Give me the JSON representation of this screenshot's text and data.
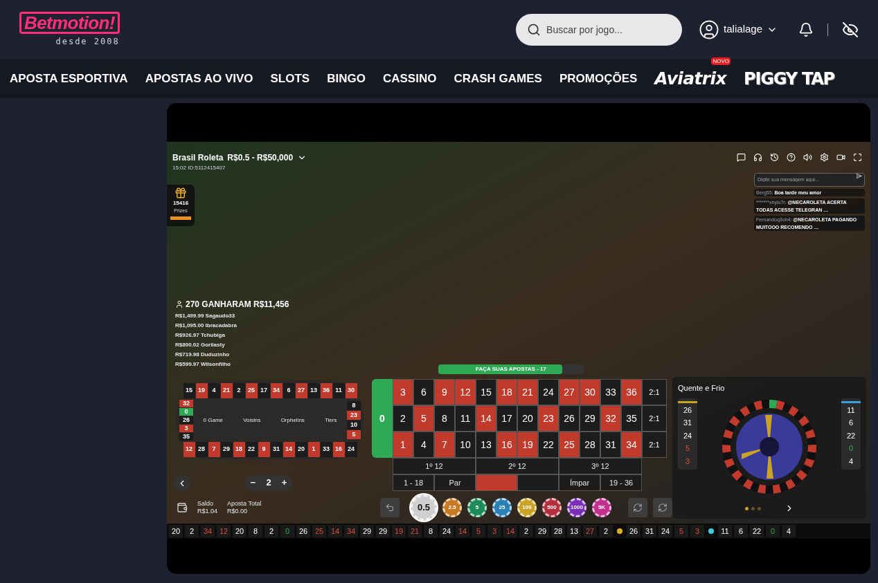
{
  "header": {
    "logo": "Betmotion!",
    "tagline": "desde 2008",
    "search": {
      "placeholder": "Buscar por jogo..."
    },
    "user": "talialage"
  },
  "nav": [
    {
      "kind": "text",
      "label": "APOSTA ESPORTIVA"
    },
    {
      "kind": "text",
      "label": "APOSTAS AO VIVO"
    },
    {
      "kind": "text",
      "label": "SLOTS"
    },
    {
      "kind": "text",
      "label": "BINGO"
    },
    {
      "kind": "text",
      "label": "CASSINO"
    },
    {
      "kind": "text",
      "label": "CRASH GAMES"
    },
    {
      "kind": "text",
      "label": "PROMOÇÕES"
    },
    {
      "kind": "script-logo",
      "label": "Aviatrix",
      "badge": "NOVO"
    },
    {
      "kind": "block-logo",
      "label": "PIGGY TAP"
    }
  ],
  "game": {
    "title": "Brasil Roleta",
    "limits": "R$0.5 - R$50,000",
    "info": "15:02 ID:5112415407",
    "prize": {
      "count": "15416",
      "label": "Prizes"
    },
    "winners": {
      "headline": "270 GANHARAM R$11,456",
      "list": [
        "R$1,499.99 Sagaudo33",
        "R$1,095.00 Ibracadabra",
        "R$926.97 Tchubiga",
        "R$800.02 Gorilasty",
        "R$719.98 Duduzinho",
        "R$599.97 Wilsonfilho"
      ]
    },
    "chat": {
      "placeholder": "Digite sua mensagem aqui...",
      "messages": [
        {
          "user": "Berg55:",
          "text": "Boa tarde meu amor"
        },
        {
          "user": "*******xhyiu7r:",
          "text": "@NECAROLETA ACERTA TODAS ACESSE TELEGRAN …"
        },
        {
          "user": "Fernandoq3ob4:",
          "text": "@NECAROLETA PAGANDO MUITOOO RECOMENDO …"
        }
      ]
    },
    "racetrack": {
      "top": [
        {
          "label": "15",
          "color": "#1c1c1c"
        },
        {
          "label": "19",
          "color": "#c23a2b"
        },
        {
          "label": "4",
          "color": "#1c1c1c"
        },
        {
          "label": "21",
          "color": "#c23a2b"
        },
        {
          "label": "2",
          "color": "#1c1c1c"
        },
        {
          "label": "25",
          "color": "#c23a2b"
        },
        {
          "label": "17",
          "color": "#1c1c1c"
        },
        {
          "label": "34",
          "color": "#c23a2b"
        },
        {
          "label": "6",
          "color": "#1c1c1c"
        },
        {
          "label": "27",
          "color": "#c23a2b"
        },
        {
          "label": "13",
          "color": "#1c1c1c"
        },
        {
          "label": "36",
          "color": "#c23a2b"
        },
        {
          "label": "11",
          "color": "#1c1c1c"
        },
        {
          "label": "30",
          "color": "#c23a2b"
        }
      ],
      "left": [
        {
          "label": "32",
          "color": "#c23a2b"
        },
        {
          "label": "0",
          "color": "#2eaa55"
        },
        {
          "label": "26",
          "color": "#1c1c1c"
        },
        {
          "label": "3",
          "color": "#c23a2b"
        },
        {
          "label": "35",
          "color": "#1c1c1c"
        }
      ],
      "right": [
        {
          "label": "8",
          "color": "#1c1c1c"
        },
        {
          "label": "23",
          "color": "#c23a2b"
        },
        {
          "label": "10",
          "color": "#1c1c1c"
        },
        {
          "label": "5",
          "color": "#c23a2b"
        }
      ],
      "bottom": [
        {
          "label": "12",
          "color": "#c23a2b"
        },
        {
          "label": "28",
          "color": "#1c1c1c"
        },
        {
          "label": "7",
          "color": "#c23a2b"
        },
        {
          "label": "29",
          "color": "#1c1c1c"
        },
        {
          "label": "18",
          "color": "#c23a2b"
        },
        {
          "label": "22",
          "color": "#1c1c1c"
        },
        {
          "label": "9",
          "color": "#c23a2b"
        },
        {
          "label": "31",
          "color": "#1c1c1c"
        },
        {
          "label": "14",
          "color": "#c23a2b"
        },
        {
          "label": "20",
          "color": "#1c1c1c"
        },
        {
          "label": "1",
          "color": "#c23a2b"
        },
        {
          "label": "33",
          "color": "#1c1c1c"
        },
        {
          "label": "16",
          "color": "#c23a2b"
        },
        {
          "label": "24",
          "color": "#1c1c1c"
        }
      ],
      "sections": [
        "0 Game",
        "Voisins",
        "Orphelins",
        "Tiers"
      ]
    },
    "stepper": {
      "minus": "−",
      "value": "2",
      "plus": "+"
    },
    "balance": {
      "label": "Saldo",
      "value": "R$1.04"
    },
    "total_bet": {
      "label": "Aposta Total",
      "value": "R$0.00"
    },
    "timer": {
      "label": "FAÇA SUAS APOSTAS - 17",
      "level": 0.85
    },
    "table": {
      "zero": {
        "label": "0",
        "color": "#2eaa55"
      },
      "number_rows": [
        [
          {
            "label": "3",
            "color": "#c23a2b"
          },
          {
            "label": "6",
            "color": "#1c1c1c"
          },
          {
            "label": "9",
            "color": "#c23a2b"
          },
          {
            "label": "12",
            "color": "#c23a2b"
          },
          {
            "label": "15",
            "color": "#1c1c1c"
          },
          {
            "label": "18",
            "color": "#c23a2b"
          },
          {
            "label": "21",
            "color": "#c23a2b"
          },
          {
            "label": "24",
            "color": "#1c1c1c"
          },
          {
            "label": "27",
            "color": "#c23a2b"
          },
          {
            "label": "30",
            "color": "#c23a2b"
          },
          {
            "label": "33",
            "color": "#1c1c1c"
          },
          {
            "label": "36",
            "color": "#c23a2b"
          }
        ],
        [
          {
            "label": "2",
            "color": "#1c1c1c"
          },
          {
            "label": "5",
            "color": "#c23a2b"
          },
          {
            "label": "8",
            "color": "#1c1c1c"
          },
          {
            "label": "11",
            "color": "#1c1c1c"
          },
          {
            "label": "14",
            "color": "#c23a2b"
          },
          {
            "label": "17",
            "color": "#1c1c1c"
          },
          {
            "label": "20",
            "color": "#1c1c1c"
          },
          {
            "label": "23",
            "color": "#c23a2b"
          },
          {
            "label": "26",
            "color": "#1c1c1c"
          },
          {
            "label": "29",
            "color": "#1c1c1c"
          },
          {
            "label": "32",
            "color": "#c23a2b"
          },
          {
            "label": "35",
            "color": "#1c1c1c"
          }
        ],
        [
          {
            "label": "1",
            "color": "#c23a2b"
          },
          {
            "label": "4",
            "color": "#1c1c1c"
          },
          {
            "label": "7",
            "color": "#c23a2b"
          },
          {
            "label": "10",
            "color": "#1c1c1c"
          },
          {
            "label": "13",
            "color": "#1c1c1c"
          },
          {
            "label": "16",
            "color": "#c23a2b"
          },
          {
            "label": "19",
            "color": "#c23a2b"
          },
          {
            "label": "22",
            "color": "#1c1c1c"
          },
          {
            "label": "25",
            "color": "#c23a2b"
          },
          {
            "label": "28",
            "color": "#1c1c1c"
          },
          {
            "label": "31",
            "color": "#1c1c1c"
          },
          {
            "label": "34",
            "color": "#c23a2b"
          }
        ]
      ],
      "columns": [
        "2:1",
        "2:1",
        "2:1"
      ],
      "dozens": [
        "1º 12",
        "2º 12",
        "3º 12"
      ],
      "outside": [
        {
          "kind": "text",
          "label": "1 - 18"
        },
        {
          "kind": "text",
          "label": "Par"
        },
        {
          "kind": "swatch",
          "color": "#c23a2b"
        },
        {
          "kind": "swatch",
          "color": "#1c1c1c"
        },
        {
          "kind": "text",
          "label": "Ímpar"
        },
        {
          "kind": "text",
          "label": "19 - 36"
        }
      ]
    },
    "chips": [
      {
        "label": "0.5",
        "color": "#cfcfcf",
        "selected": true
      },
      {
        "label": "2.5",
        "color": "#c77a26",
        "selected": false
      },
      {
        "label": "5",
        "color": "#1f8a5a",
        "selected": false
      },
      {
        "label": "25",
        "color": "#2a7fb5",
        "selected": false
      },
      {
        "label": "100",
        "color": "#c9a227",
        "selected": false
      },
      {
        "label": "500",
        "color": "#b3303a",
        "selected": false
      },
      {
        "label": "1000",
        "color": "#7b2fb8",
        "selected": false
      },
      {
        "label": "5K",
        "color": "#c0308c",
        "selected": false
      }
    ],
    "hot_cold": {
      "title": "Quente e Frio",
      "hot": [
        {
          "label": "26",
          "kind": "black"
        },
        {
          "label": "31",
          "kind": "black"
        },
        {
          "label": "24",
          "kind": "black"
        },
        {
          "label": "5",
          "kind": "red"
        },
        {
          "label": "3",
          "kind": "red"
        }
      ],
      "cold": [
        {
          "label": "11",
          "kind": "black"
        },
        {
          "label": "6",
          "kind": "black"
        },
        {
          "label": "22",
          "kind": "black"
        },
        {
          "label": "0",
          "kind": "green"
        },
        {
          "label": "4",
          "kind": "black"
        }
      ]
    },
    "history": {
      "recent": [
        {
          "label": "20",
          "kind": "black"
        },
        {
          "label": "2",
          "kind": "black"
        },
        {
          "label": "34",
          "kind": "red"
        },
        {
          "label": "12",
          "kind": "red"
        },
        {
          "label": "20",
          "kind": "black"
        },
        {
          "label": "8",
          "kind": "black"
        },
        {
          "label": "2",
          "kind": "black"
        },
        {
          "label": "0",
          "kind": "green"
        },
        {
          "label": "26",
          "kind": "black"
        },
        {
          "label": "25",
          "kind": "red"
        },
        {
          "label": "14",
          "kind": "red"
        },
        {
          "label": "34",
          "kind": "red"
        },
        {
          "label": "29",
          "kind": "black"
        },
        {
          "label": "29",
          "kind": "black"
        },
        {
          "label": "19",
          "kind": "red"
        },
        {
          "label": "21",
          "kind": "red"
        },
        {
          "label": "8",
          "kind": "black"
        },
        {
          "label": "24",
          "kind": "black"
        },
        {
          "label": "14",
          "kind": "red"
        },
        {
          "label": "5",
          "kind": "red"
        },
        {
          "label": "3",
          "kind": "red"
        },
        {
          "label": "14",
          "kind": "red"
        },
        {
          "label": "2",
          "kind": "black"
        },
        {
          "label": "29",
          "kind": "black"
        },
        {
          "label": "28",
          "kind": "black"
        },
        {
          "label": "13",
          "kind": "black"
        },
        {
          "label": "27",
          "kind": "red"
        },
        {
          "label": "2",
          "kind": "black"
        }
      ],
      "hot": [
        {
          "label": "26",
          "kind": "black"
        },
        {
          "label": "31",
          "kind": "black"
        },
        {
          "label": "24",
          "kind": "black"
        },
        {
          "label": "5",
          "kind": "red"
        },
        {
          "label": "3",
          "kind": "red"
        }
      ],
      "cold": [
        {
          "label": "11",
          "kind": "black"
        },
        {
          "label": "6",
          "kind": "black"
        },
        {
          "label": "22",
          "kind": "black"
        },
        {
          "label": "0",
          "kind": "green"
        },
        {
          "label": "4",
          "kind": "black"
        }
      ]
    }
  }
}
